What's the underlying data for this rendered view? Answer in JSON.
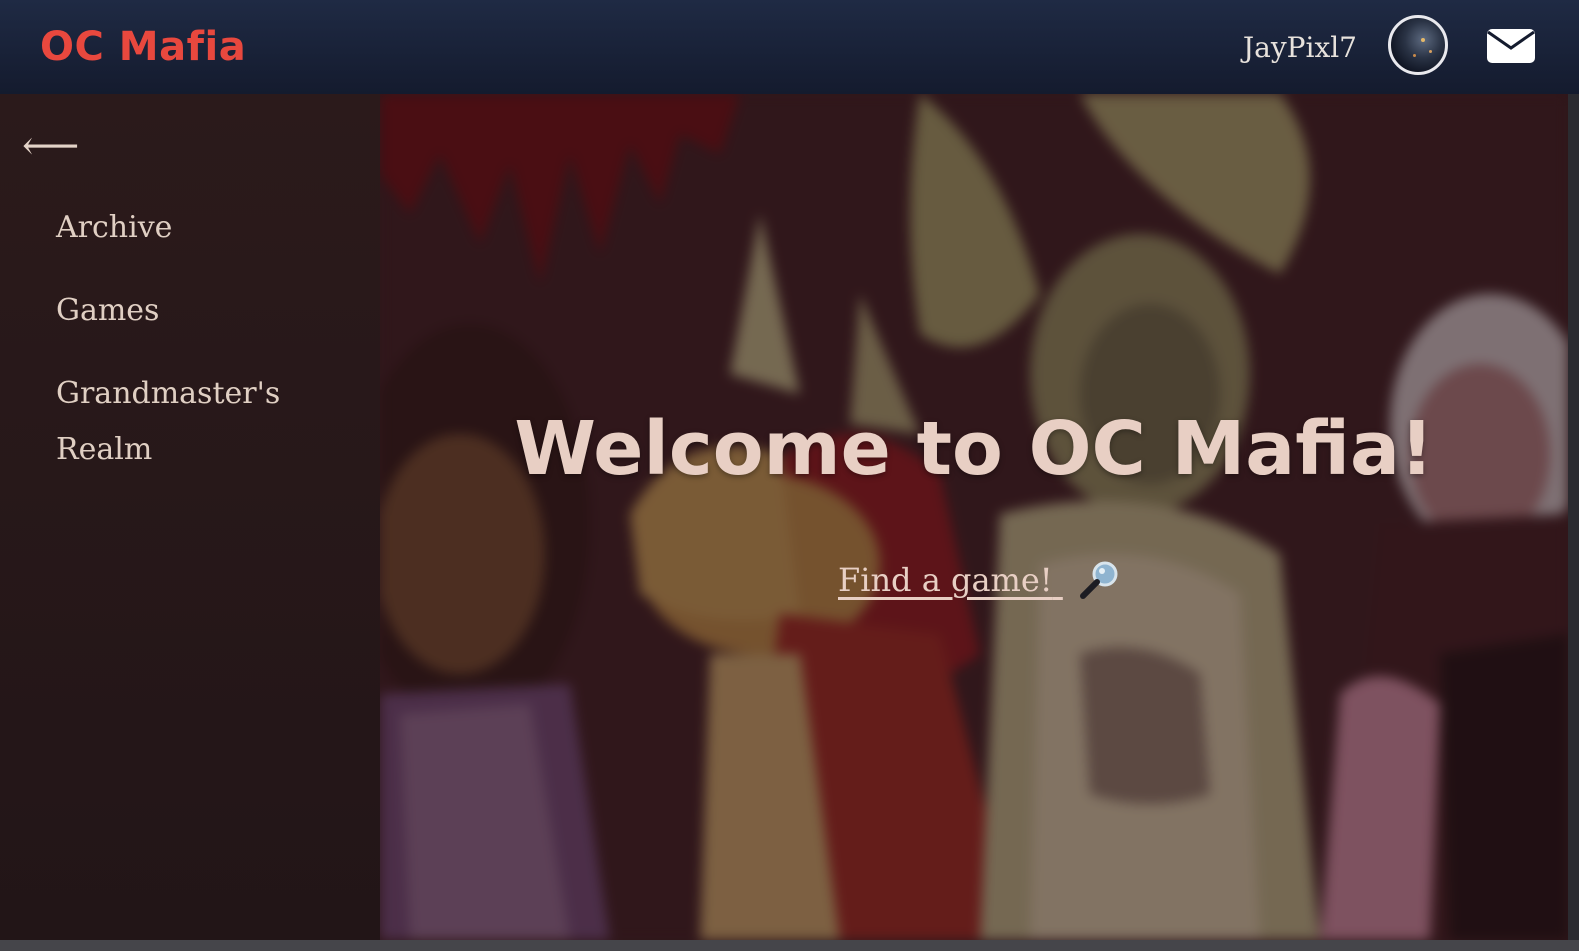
{
  "header": {
    "brand": "OC Mafia",
    "username": "JayPixl7",
    "avatar_icon": "user-avatar",
    "mail_icon": "envelope-icon"
  },
  "sidebar": {
    "back_icon": "arrow-left-icon",
    "back_glyph": "⟵",
    "items": [
      {
        "label": "Archive"
      },
      {
        "label": "Games"
      },
      {
        "label": "Grandmaster's Realm"
      }
    ]
  },
  "hero": {
    "title": "Welcome to OC Mafia!",
    "cta_label": "Find a game!",
    "cta_icon": "magnifying-glass-icon"
  },
  "colors": {
    "brand": "#e8483e",
    "topbar": "#1a2338",
    "sidebar": "#261819",
    "text_light": "#e8cfc4"
  }
}
